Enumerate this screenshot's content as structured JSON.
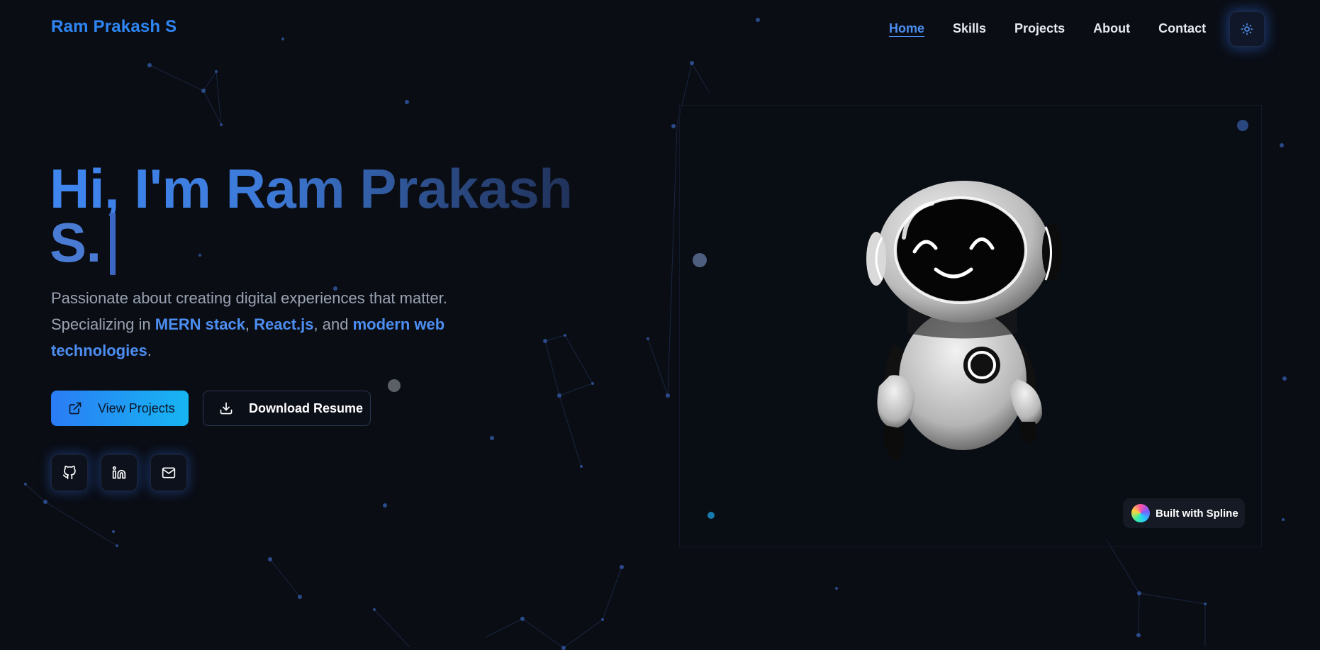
{
  "header": {
    "logo": "Ram Prakash S",
    "nav": [
      {
        "label": "Home",
        "active": true
      },
      {
        "label": "Skills",
        "active": false
      },
      {
        "label": "Projects",
        "active": false
      },
      {
        "label": "About",
        "active": false
      },
      {
        "label": "Contact",
        "active": false
      }
    ],
    "theme_toggle_icon": "sun-icon"
  },
  "hero": {
    "title_line1": "Hi, I'm Ram Prakash",
    "title_line2": "S.",
    "description": {
      "line1": "Passionate about creating digital experiences that matter.",
      "prefix": "Specializing in ",
      "mern": "MERN stack",
      "sep1": ", ",
      "react": "React.js",
      "sep2": ", and ",
      "modern": "modern web technologies",
      "end": "."
    },
    "buttons": {
      "view_projects": "View Projects",
      "download_resume": "Download Resume"
    },
    "social": [
      "github-icon",
      "linkedin-icon",
      "mail-icon"
    ]
  },
  "scene": {
    "badge": "Built with Spline"
  },
  "colors": {
    "accent": "#2f86f3",
    "background": "#0a0d14",
    "cyan": "#17b6f2"
  }
}
